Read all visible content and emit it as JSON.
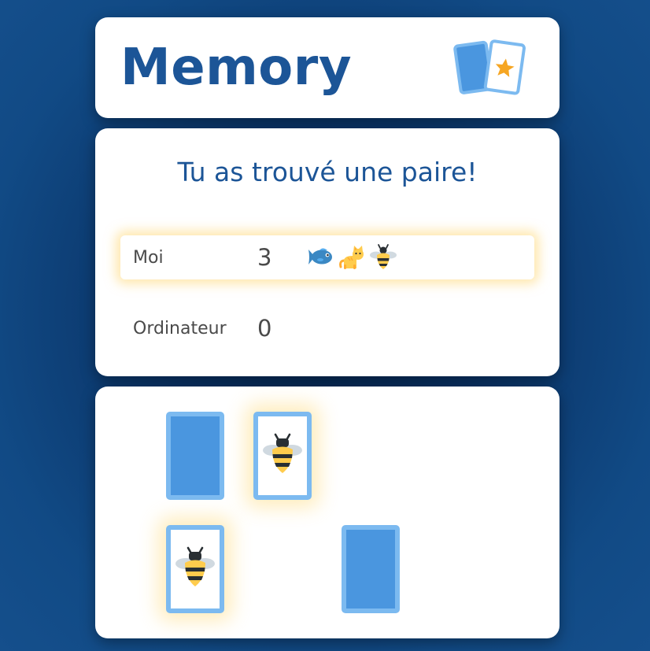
{
  "header": {
    "title": "Memory",
    "logo_icon": "cards-star-icon"
  },
  "score": {
    "status": "Tu as trouvé une paire!",
    "players": [
      {
        "name": "Moi",
        "score": "3",
        "active": true,
        "pairs": [
          "fish-icon",
          "cat-icon",
          "bee-icon"
        ]
      },
      {
        "name": "Ordinateur",
        "score": "0",
        "active": false,
        "pairs": []
      }
    ]
  },
  "board": {
    "cards": [
      {
        "state": "face-down"
      },
      {
        "state": "face-up",
        "symbol": "bee-icon"
      },
      {
        "state": "face-up",
        "symbol": "bee-icon"
      },
      {
        "state": "face-down"
      }
    ]
  },
  "colors": {
    "title_blue": "#1c5597",
    "card_back": "#4a96df",
    "card_border": "#7cbaf0",
    "highlight_glow": "#ffd66e",
    "star": "#f6a623"
  }
}
